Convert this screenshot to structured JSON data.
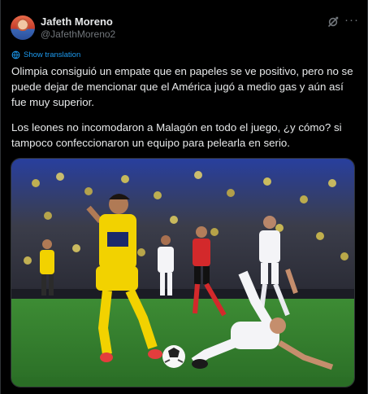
{
  "author": {
    "display_name": "Jafeth Moreno",
    "handle": "@JafethMoreno2"
  },
  "actions": {
    "grok_icon": "grok-icon",
    "more_icon": "more-icon",
    "more_glyph": "···"
  },
  "translate": {
    "label": "Show translation"
  },
  "tweet": {
    "paragraphs": [
      "Olimpia consiguió un empate que en papeles se ve positivo, pero no se puede dejar de mencionar que el América jugó a medio gas y aún así fue muy superior.",
      "Los leones no incomodaron a Malagón en todo el juego, ¿y cómo? si tampoco confeccionaron un equipo para pelearla en serio."
    ]
  },
  "media": {
    "type": "photo",
    "description_colors": {
      "pitch": "#2f7d32",
      "america_kit": "#f2d200",
      "olimpia_kit": "#f4f4f7",
      "referee": "#d3292b"
    }
  },
  "colors": {
    "background": "#000000",
    "text_primary": "#e7e9ea",
    "text_secondary": "#71767b",
    "accent": "#1d9bf0"
  }
}
